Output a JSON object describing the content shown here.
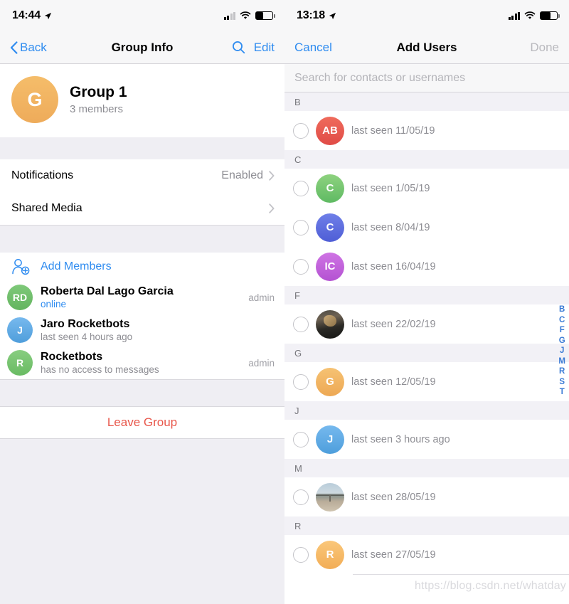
{
  "left": {
    "status_bar": {
      "time": "14:44",
      "location_icon": "location-arrow-icon",
      "signal_bars": 2,
      "wifi_icon": "wifi-icon",
      "battery_icon": "battery-icon",
      "battery_level": 45
    },
    "nav": {
      "back_label": "Back",
      "title": "Group Info",
      "search_icon": "search-icon",
      "edit_label": "Edit"
    },
    "group": {
      "avatar_initial": "G",
      "avatar_color": "#f0b463",
      "name": "Group 1",
      "members_count": "3 members"
    },
    "settings_rows": [
      {
        "label": "Notifications",
        "value": "Enabled",
        "chevron": "chevron-right-icon"
      },
      {
        "label": "Shared Media",
        "value": "",
        "chevron": "chevron-right-icon"
      }
    ],
    "add_members": {
      "icon": "add-person-icon",
      "label": "Add Members"
    },
    "members": [
      {
        "initials": "RD",
        "avatar_color": "#70bd6b",
        "name": "Roberta Dal Lago Garcia",
        "status": "online",
        "status_type": "online",
        "role": "admin"
      },
      {
        "initials": "J",
        "avatar_color": "#5eaae2",
        "name": "Jaro Rocketbots",
        "status": "last seen 4 hours ago",
        "status_type": "muted",
        "role": ""
      },
      {
        "initials": "R",
        "avatar_color": "#77c46f",
        "name": "Rocketbots",
        "status": "has no access to messages",
        "status_type": "muted",
        "role": "admin"
      }
    ],
    "leave": {
      "label": "Leave Group",
      "color": "#e8564a"
    }
  },
  "right": {
    "status_bar": {
      "time": "13:18",
      "location_icon": "location-arrow-icon",
      "signal_bars": 4,
      "wifi_icon": "wifi-icon",
      "battery_icon": "battery-icon",
      "battery_level": 62
    },
    "nav": {
      "cancel_label": "Cancel",
      "title": "Add Users",
      "done_label": "Done"
    },
    "search": {
      "value": "",
      "placeholder": "Search for contacts or usernames"
    },
    "sections": [
      {
        "letter": "B",
        "contacts": [
          {
            "avatar_type": "initials",
            "initials": "AB",
            "avatar_color": "#e8594f",
            "name": "",
            "status": "last seen 11/05/19",
            "checked": false
          }
        ]
      },
      {
        "letter": "C",
        "contacts": [
          {
            "avatar_type": "initials",
            "initials": "C",
            "avatar_color": "#74c46c",
            "name": "",
            "status": "last seen 1/05/19",
            "checked": false
          },
          {
            "avatar_type": "initials",
            "initials": "C",
            "avatar_color": "#5b6fe0",
            "name": "",
            "status": "last seen 8/04/19",
            "checked": false
          },
          {
            "avatar_type": "initials",
            "initials": "IC",
            "avatar_color": "#c162dc",
            "name": "",
            "status": "last seen 16/04/19",
            "checked": false
          }
        ]
      },
      {
        "letter": "F",
        "contacts": [
          {
            "avatar_type": "photo-dark",
            "initials": "",
            "avatar_color": "#4c4a44",
            "name": "",
            "status": "last seen 22/02/19",
            "checked": false
          }
        ]
      },
      {
        "letter": "G",
        "contacts": [
          {
            "avatar_type": "initials",
            "initials": "G",
            "avatar_color": "#f0b463",
            "name": "",
            "status": "last seen 12/05/19",
            "checked": false
          }
        ]
      },
      {
        "letter": "J",
        "contacts": [
          {
            "avatar_type": "initials",
            "initials": "J",
            "avatar_color": "#5eaae2",
            "name": "",
            "status": "last seen 3 hours ago",
            "checked": false
          }
        ]
      },
      {
        "letter": "M",
        "contacts": [
          {
            "avatar_type": "photo-beach",
            "initials": "",
            "avatar_color": "#b9cdda",
            "name": "",
            "status": "last seen 28/05/19",
            "checked": false
          }
        ]
      },
      {
        "letter": "R",
        "contacts": [
          {
            "avatar_type": "initials",
            "initials": "R",
            "avatar_color": "#f5b860",
            "name": "",
            "status": "last seen 27/05/19",
            "checked": false
          }
        ]
      }
    ],
    "alpha_index": [
      "B",
      "C",
      "F",
      "G",
      "J",
      "M",
      "R",
      "S",
      "T"
    ],
    "accent_color": "#3a7bd5"
  },
  "watermark": {
    "text": "https://blog.csdn.net/whatday"
  }
}
